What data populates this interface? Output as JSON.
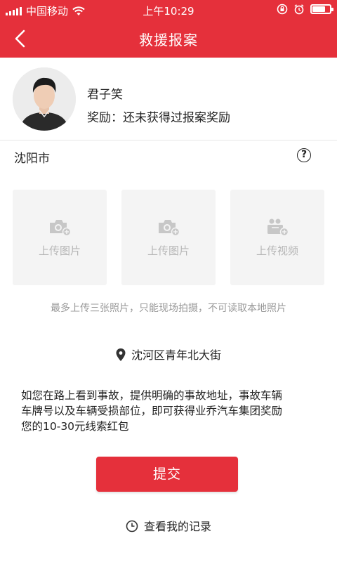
{
  "status_bar": {
    "carrier": "中国移动",
    "time": "上午10:29",
    "battery_level": 0.75
  },
  "nav": {
    "title": "救援报案",
    "back_icon": "back-arrow-icon"
  },
  "profile": {
    "name": "君子笑",
    "reward_text": "奖励：还未获得过报案奖励"
  },
  "city": {
    "name": "沈阳市",
    "help_symbol": "?"
  },
  "uploads": [
    {
      "label": "上传图片",
      "icon": "camera-plus-icon"
    },
    {
      "label": "上传图片",
      "icon": "camera-plus-icon"
    },
    {
      "label": "上传视频",
      "icon": "video-plus-icon"
    }
  ],
  "hint": "最多上传三张照片，只能现场拍摄，不可读取本地照片",
  "location": "沈河区青年北大街",
  "description_lines": [
    "如您在路上看到事故，提供明确的事故地址，事故车辆",
    "车牌号以及车辆受损部位，即可获得业乔汽车集团奖励",
    "您的10-30元线索红包"
  ],
  "submit_label": "提交",
  "records_label": "查看我的记录",
  "colors": {
    "brand_red": "#e5303b",
    "tile_bg": "#f4f4f4",
    "muted_text": "#999999"
  }
}
